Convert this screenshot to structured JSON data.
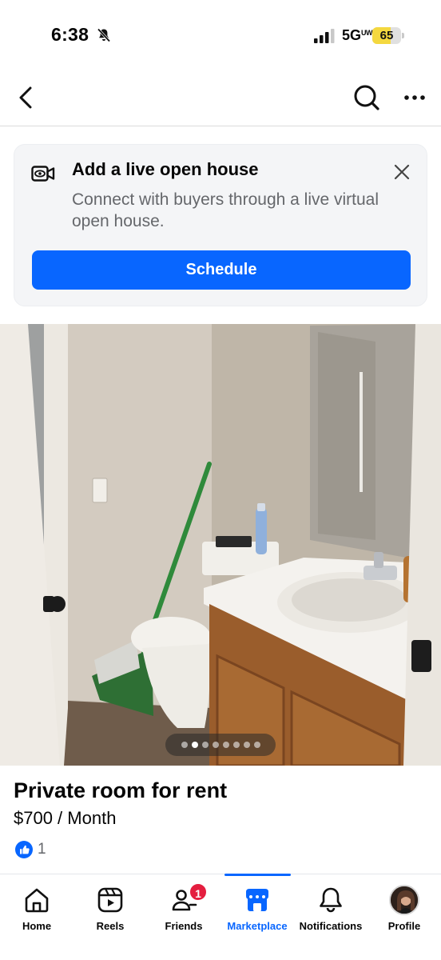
{
  "status_bar": {
    "time": "6:38",
    "network": "5G",
    "network_suffix": "UW",
    "battery": "65",
    "battery_level": 0.65,
    "battery_color": "#f4d83f"
  },
  "header": {
    "back_icon": "chevron-left-icon",
    "search_icon": "search-icon",
    "more_icon": "more-horizontal-icon"
  },
  "live_card": {
    "title": "Add a live open house",
    "description": "Connect with buyers through a live virtual open house.",
    "button_label": "Schedule",
    "button_color": "#0866ff",
    "icon": "video-camera-icon",
    "close_icon": "close-icon"
  },
  "photo": {
    "image_count": 8,
    "active_index": 1
  },
  "listing": {
    "title": "Private room for rent",
    "price": "$700 / Month",
    "like_count": "1"
  },
  "bottom_nav": {
    "items": [
      {
        "label": "Home",
        "icon": "home-icon"
      },
      {
        "label": "Reels",
        "icon": "reels-icon"
      },
      {
        "label": "Friends",
        "icon": "friends-icon",
        "badge": "1"
      },
      {
        "label": "Marketplace",
        "icon": "marketplace-icon",
        "active": true
      },
      {
        "label": "Notifications",
        "icon": "bell-icon"
      },
      {
        "label": "Profile",
        "icon": "avatar"
      }
    ],
    "accent": "#0866ff"
  }
}
